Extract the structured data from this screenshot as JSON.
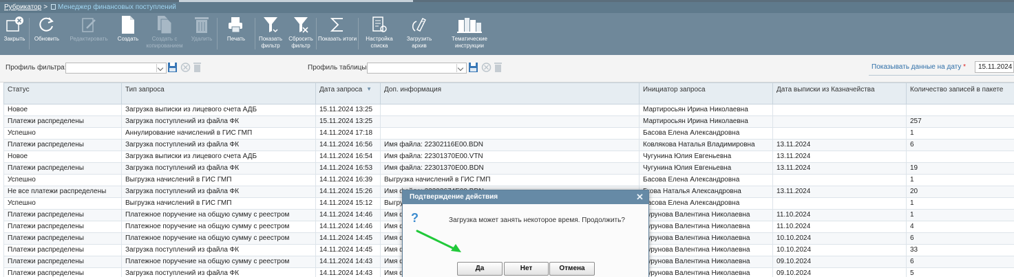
{
  "breadcrumb": {
    "root": "Рубрикатор",
    "separator": ">",
    "current": "Менеджер финансовых поступлений"
  },
  "toolbar": {
    "buttons": [
      {
        "label": "Закрыть",
        "icon": "close-window-icon",
        "enabled": true
      },
      {
        "label": "Обновить",
        "icon": "refresh-icon",
        "enabled": true
      },
      {
        "label": "Редактировать",
        "icon": "edit-icon",
        "enabled": false
      },
      {
        "label": "Создать",
        "icon": "new-document-icon",
        "enabled": true
      },
      {
        "label": "Создать с копированием",
        "icon": "copy-document-icon",
        "enabled": false
      },
      {
        "label": "Удалить",
        "icon": "trash-icon",
        "enabled": false
      },
      {
        "label": "Печать",
        "icon": "print-icon",
        "enabled": true
      },
      {
        "label": "Показать фильтр",
        "icon": "filter-icon",
        "enabled": true
      },
      {
        "label": "Сбросить фильтр",
        "icon": "filter-clear-icon",
        "enabled": true
      },
      {
        "label": "Показать итоги",
        "icon": "sum-icon",
        "enabled": true
      },
      {
        "label": "Настройка списка",
        "icon": "list-settings-icon",
        "enabled": true
      },
      {
        "label": "Загрузить архив",
        "icon": "upload-archive-icon",
        "enabled": true
      },
      {
        "label": "Тематические инструкции",
        "icon": "books-icon",
        "enabled": true
      }
    ]
  },
  "filters": {
    "filter_profile_label": "Профиль фильтра:",
    "filter_profile_value": "",
    "table_profile_label": "Профиль таблицы:",
    "table_profile_value": "",
    "date_link": "Показывать данные на дату",
    "date_required_mark": "*",
    "date_value": "15.11.2024"
  },
  "table": {
    "columns": [
      "Статус",
      "Тип запроса",
      "Дата запроса",
      "Доп. информация",
      "Инициатор запроса",
      "Дата выписки из Казначейства",
      "Количество записей в пакете"
    ],
    "rows": [
      [
        "Новое",
        "Загрузка выписки из лицевого счета АДБ",
        "15.11.2024 13:25",
        "",
        "Мартиросьян Ирина Николаевна",
        "",
        ""
      ],
      [
        "Платежи распределены",
        "Загрузка поступлений из файла ФК",
        "15.11.2024 13:25",
        "",
        "Мартиросьян Ирина Николаевна",
        "",
        "257"
      ],
      [
        "Успешно",
        "Аннулирование начислений в ГИС ГМП",
        "14.11.2024 17:18",
        "",
        "Басова Елена Александровна",
        "",
        "1"
      ],
      [
        "Платежи распределены",
        "Загрузка поступлений из файла ФК",
        "14.11.2024 16:56",
        "Имя файла: 22302116E00.BDN",
        "Ковлякова Наталья Владимировна",
        "13.11.2024",
        "6"
      ],
      [
        "Новое",
        "Загрузка выписки из лицевого счета АДБ",
        "14.11.2024 16:54",
        "Имя файла: 22301370E00.VTN",
        "Чугунина Юлия Евгеньевна",
        "13.11.2024",
        ""
      ],
      [
        "Платежи распределены",
        "Загрузка поступлений из файла ФК",
        "14.11.2024 16:53",
        "Имя файла: 22301370E00.BDN",
        "Чугунина Юлия Евгеньевна",
        "13.11.2024",
        "19"
      ],
      [
        "Успешно",
        "Выгрузка начислений в ГИС ГМП",
        "14.11.2024 16:39",
        "Выгрузка начислений в ГИС ГМП",
        "Басова Елена Александровна",
        "",
        "1"
      ],
      [
        "Не все платежи распределены",
        "Загрузка поступлений из файла ФК",
        "14.11.2024 15:26",
        "Имя файла: 22303674E00.BDN",
        "Гкова Наталья Александровна",
        "13.11.2024",
        "20"
      ],
      [
        "Успешно",
        "Выгрузка начислений в ГИС ГМП",
        "14.11.2024 15:12",
        "Выгрузка начислений в ГИС ГМП",
        "Басова Елена Александровна",
        "",
        "1"
      ],
      [
        "Платежи распределены",
        "Платежное поручение на общую сумму с реестром",
        "14.11.2024 14:46",
        "Имя файла",
        "Бурунова Валентина Николаевна",
        "11.10.2024",
        "1"
      ],
      [
        "Платежи распределены",
        "Платежное поручение на общую сумму с реестром",
        "14.11.2024 14:46",
        "Имя файла",
        "Бурунова Валентина Николаевна",
        "11.10.2024",
        "4"
      ],
      [
        "Платежи распределены",
        "Платежное поручение на общую сумму с реестром",
        "14.11.2024 14:45",
        "Имя файла",
        "Бурунова Валентина Николаевна",
        "10.10.2024",
        "6"
      ],
      [
        "Платежи распределены",
        "Загрузка поступлений из файла ФК",
        "14.11.2024 14:45",
        "Имя файла",
        "Бурунова Валентина Николаевна",
        "10.10.2024",
        "33"
      ],
      [
        "Платежи распределены",
        "Платежное поручение на общую сумму с реестром",
        "14.11.2024 14:43",
        "Имя файла",
        "Бурунова Валентина Николаевна",
        "09.10.2024",
        "6"
      ],
      [
        "Платежи распределены",
        "Загрузка поступлений из файла ФК",
        "14.11.2024 14:43",
        "Имя файла",
        "Бурунова Валентина Николаевна",
        "09.10.2024",
        "5"
      ]
    ]
  },
  "modal": {
    "title": "Подтверждение действия",
    "icon": "question-icon",
    "message": "Загрузка может занять некоторое время. Продолжить?",
    "yes": "Да",
    "no": "Нет",
    "cancel": "Отмена"
  },
  "colors": {
    "toolbar_bg": "#6f889a",
    "modal_title_bg": "#668aa6",
    "arrow": "#21c93a",
    "link": "#2f6fa8"
  }
}
